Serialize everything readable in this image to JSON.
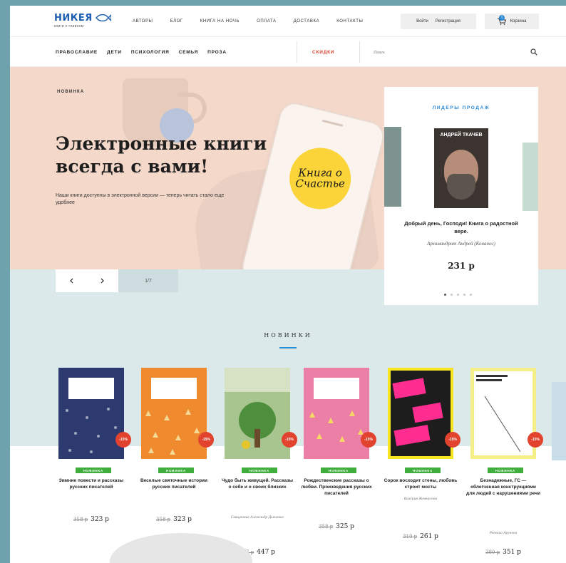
{
  "header": {
    "logo": {
      "name": "НИКЕЯ",
      "tagline": "книги о главном"
    },
    "nav": [
      "Авторы",
      "Блог",
      "Книга на ночь",
      "Оплата",
      "Доставка",
      "Контакты"
    ],
    "login": "Войти",
    "register": "Регистрация",
    "cart": {
      "label": "Корзина",
      "count": "1"
    }
  },
  "categories": [
    "ПРАВОСЛАВИЕ",
    "ДЕТИ",
    "ПСИХОЛОГИЯ",
    "СЕМЬЯ",
    "ПРОЗА"
  ],
  "sale_label": "СКИДКИ",
  "search": {
    "placeholder": "Поиск"
  },
  "hero": {
    "tag": "НОВИНКА",
    "title": "Электронные книги всегда с вами!",
    "description": "Наши книги доступны в электронной версии — теперь читать стало еще удобнее",
    "phone_badge": "Книга о Счастье",
    "counter": "1/7"
  },
  "bestsellers": {
    "title": "ЛИДЕРЫ ПРОДАЖ",
    "book": {
      "cover_author": "АНДРЕЙ ТКАЧЕВ",
      "title": "Добрый день, Господи! Книга о радостной вере.",
      "author": "Архимандрит Андрей (Конанос)",
      "price": "231 р"
    }
  },
  "novelties": {
    "title": "НОВИНКИ",
    "tag": "НОВИНКА",
    "discount": "-15%",
    "books": [
      {
        "title": "Зимние повести и рассказы русских писателей",
        "author": "",
        "old_price": "358 р",
        "price": "323 р",
        "color": "#2c3a70"
      },
      {
        "title": "Веселые святочные истории русских писателей",
        "author": "",
        "old_price": "358 р",
        "price": "323 р",
        "color": "#ef8a2e"
      },
      {
        "title": "Чудо быть живущей. Рассказы о себе и о своих близких",
        "author": "Священник Александр Дьяченко",
        "old_price": "517 р",
        "price": "447 р",
        "color": "#a8c590"
      },
      {
        "title": "Рождественские рассказы о любви. Произведения русских писателей",
        "author": "",
        "old_price": "358 р",
        "price": "325 р",
        "color": "#ec7fa5"
      },
      {
        "title": "Сорок восходит стены, любовь строит мосты",
        "author": "Валерия Жемчугова",
        "old_price": "310 р",
        "price": "261 р",
        "color": "#f7e51f"
      },
      {
        "title": "Безнадежные, ГС — облегченная конструкциями для людей с нарушениями речи",
        "author": "Ревекка Арунова",
        "old_price": "380 р",
        "price": "351 р",
        "color": "#f5ef89"
      }
    ]
  }
}
